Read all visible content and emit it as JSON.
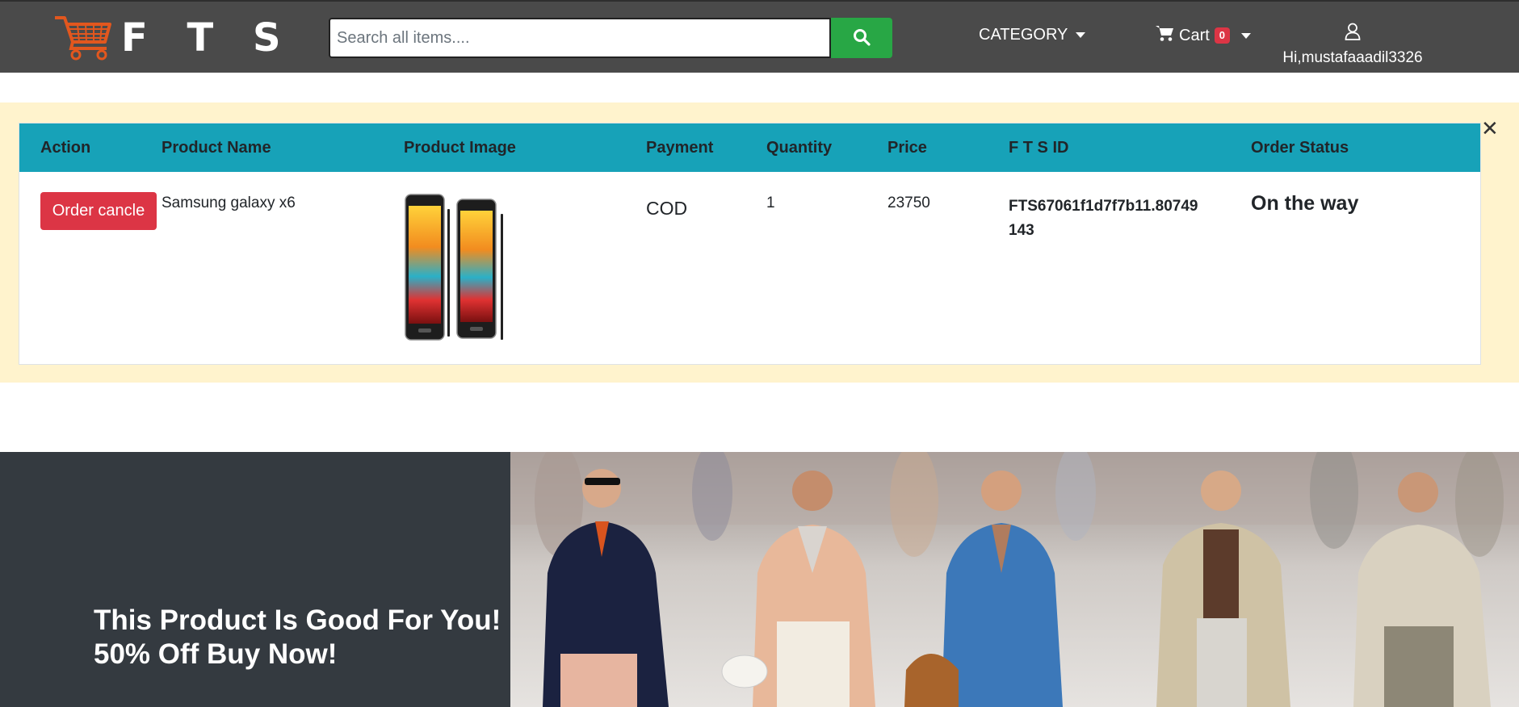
{
  "brand": {
    "name": "F T S",
    "logo_icon": "shopping-cart-logo"
  },
  "search": {
    "placeholder": "Search all items....",
    "value": "",
    "button_icon": "search-icon"
  },
  "nav": {
    "category_label": "CATEGORY",
    "cart_label": "Cart",
    "cart_count": "0",
    "user_greeting": "Hi,mustafaaadil3326"
  },
  "order_table": {
    "headers": [
      "Action",
      "Product Name",
      "Product Image",
      "Payment",
      "Quantity",
      "Price",
      "F T S ID",
      "Order Status"
    ],
    "rows": [
      {
        "action_label": "Order cancle",
        "product_name": "Samsung galaxy x6",
        "payment": "COD",
        "quantity": "1",
        "price": "23750",
        "fts_id_line1": "FTS67061f1d7f7b11.80749",
        "fts_id_line2": "143",
        "status": "On the way"
      }
    ]
  },
  "banner": {
    "line1": "This Product Is Good For You!",
    "line2": "50% Off Buy Now!"
  },
  "colors": {
    "navbar": "#4a4a4a",
    "search_button": "#28a745",
    "table_header": "#17a2b8",
    "alert_bg": "#fff3cd",
    "danger": "#dc3545",
    "banner_dark": "#343a40"
  }
}
